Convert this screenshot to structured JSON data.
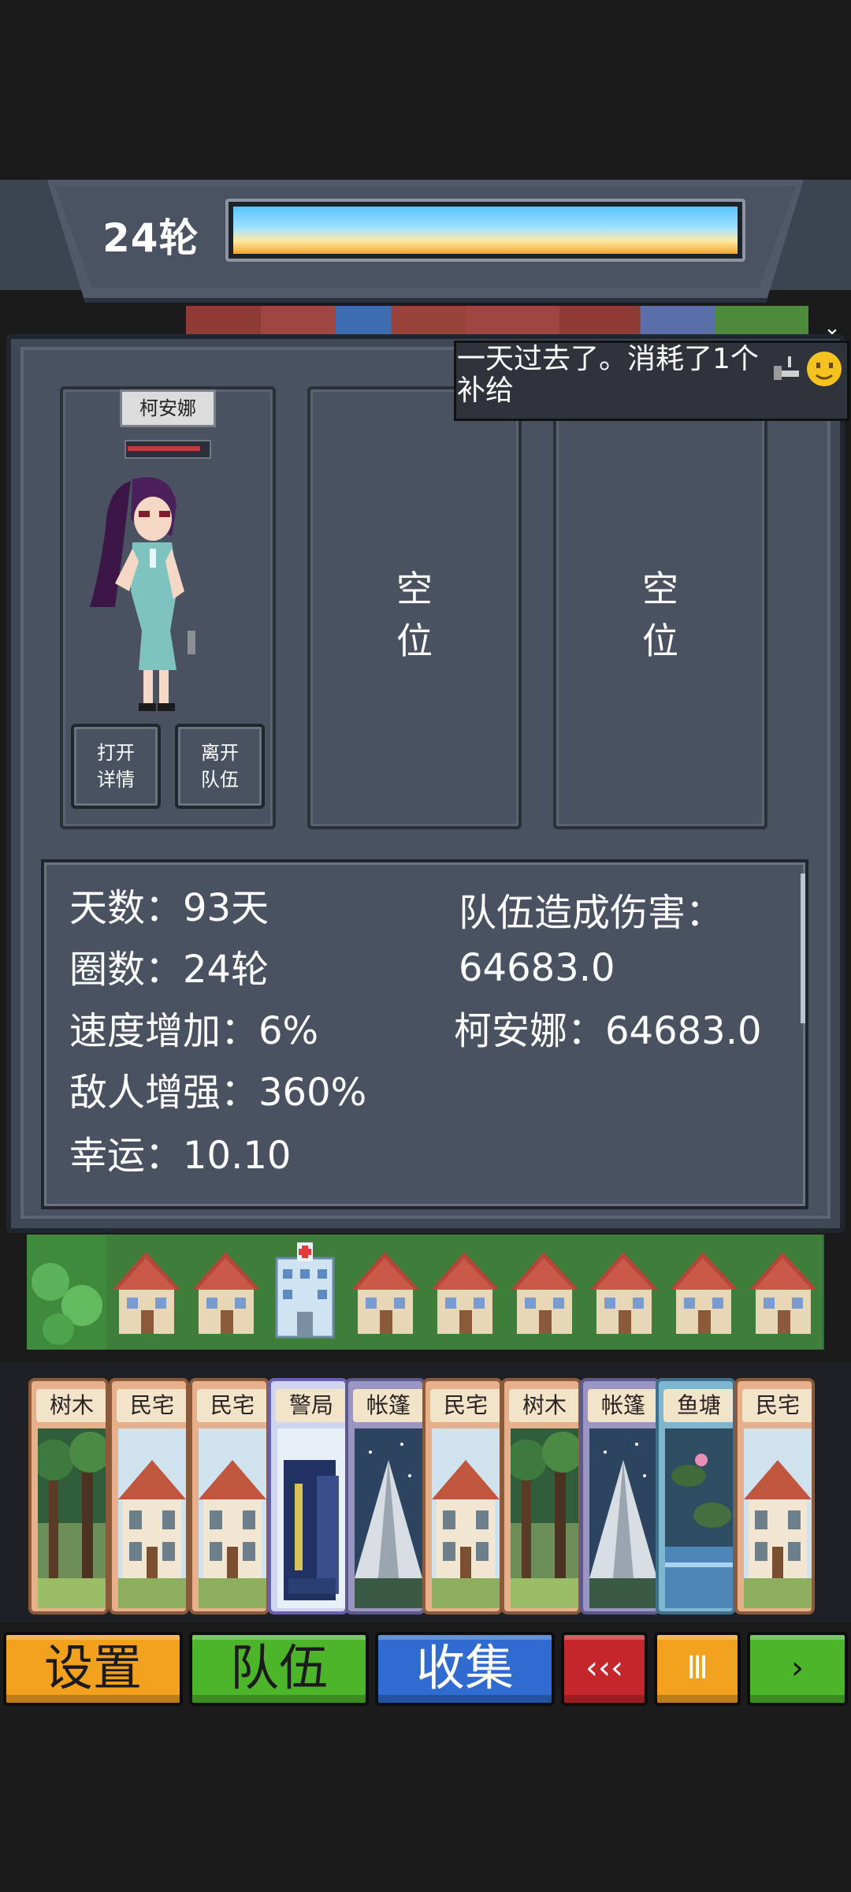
{
  "header": {
    "round_label": "24轮",
    "progress": 1.0
  },
  "toast": {
    "message": "一天过去了。消耗了1个补给",
    "icon": "pipe-smiley-icon"
  },
  "party": {
    "slots": [
      {
        "name": "柯安娜",
        "hp_fraction": 0.9,
        "detail_label": "打开\n详情",
        "leave_label": "离开\n队伍"
      },
      {
        "empty_label": "空\n位"
      },
      {
        "empty_label": "空\n位"
      }
    ]
  },
  "stats": {
    "days": "天数：93天",
    "laps": "圈数：24轮",
    "speed": "速度增加：6%",
    "enemy": "敌人增强：360%",
    "luck": "幸运：10.10",
    "damage_title": "队伍造成伤害：",
    "damage_total": "64683.0",
    "damage_member": "柯安娜：64683.0"
  },
  "map_tiles": [
    "forest",
    "house",
    "house",
    "hospital",
    "house",
    "house",
    "house",
    "house",
    "house",
    "house"
  ],
  "cards": [
    {
      "label": "树木",
      "kind": "tree"
    },
    {
      "label": "民宅",
      "kind": "house"
    },
    {
      "label": "民宅",
      "kind": "house"
    },
    {
      "label": "警局",
      "kind": "police"
    },
    {
      "label": "帐篷",
      "kind": "tent"
    },
    {
      "label": "民宅",
      "kind": "house"
    },
    {
      "label": "树木",
      "kind": "tree"
    },
    {
      "label": "帐篷",
      "kind": "tent"
    },
    {
      "label": "鱼塘",
      "kind": "pond"
    },
    {
      "label": "民宅",
      "kind": "house"
    }
  ],
  "buttons": {
    "settings": "设置",
    "team": "队伍",
    "collection": "收集",
    "rewind": "‹‹‹",
    "pause": "Ⅲ",
    "play": "›"
  },
  "colors": {
    "settings": "#f2a11f",
    "team": "#4db52a",
    "collection": "#2f6bd0",
    "rewind": "#c4262b",
    "pause": "#f2a11f",
    "play": "#4db52a"
  }
}
